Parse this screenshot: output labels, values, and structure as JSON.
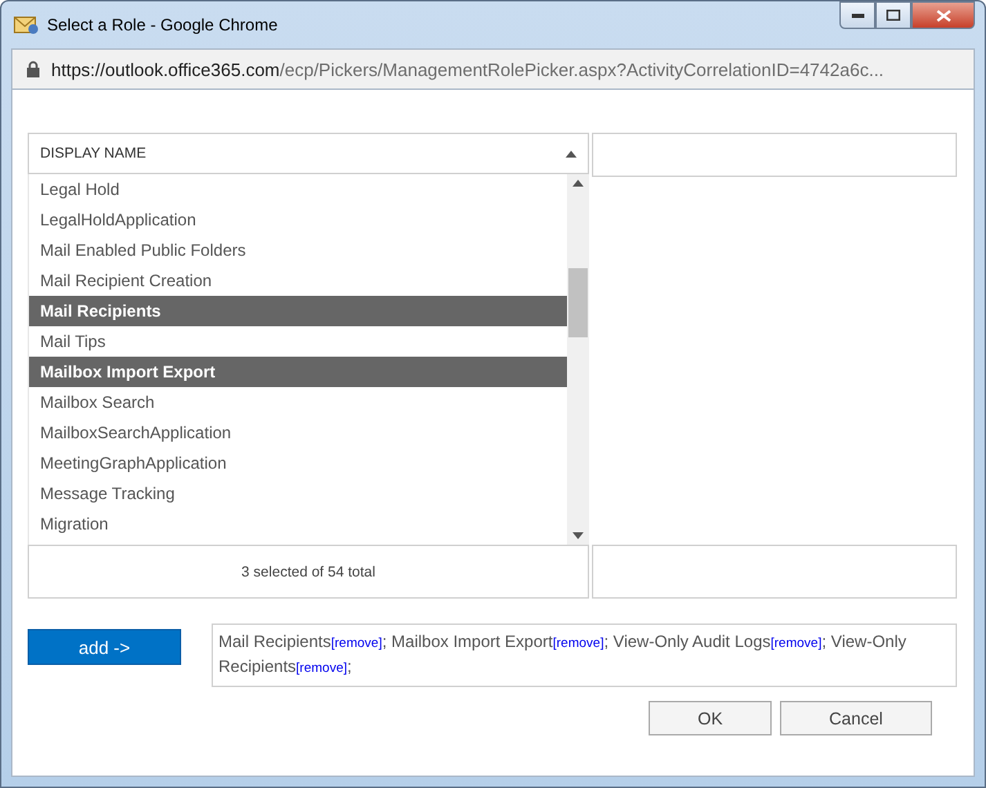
{
  "window": {
    "title": "Select a Role - Google Chrome"
  },
  "address_bar": {
    "host": "https://outlook.office365.com",
    "path": "/ecp/Pickers/ManagementRolePicker.aspx?ActivityCorrelationID=4742a6c..."
  },
  "list": {
    "header": "DISPLAY NAME",
    "items": [
      {
        "label": "Legal Hold",
        "selected": false
      },
      {
        "label": "LegalHoldApplication",
        "selected": false
      },
      {
        "label": "Mail Enabled Public Folders",
        "selected": false
      },
      {
        "label": "Mail Recipient Creation",
        "selected": false
      },
      {
        "label": "Mail Recipients",
        "selected": true
      },
      {
        "label": "Mail Tips",
        "selected": false
      },
      {
        "label": "Mailbox Import Export",
        "selected": true
      },
      {
        "label": "Mailbox Search",
        "selected": false
      },
      {
        "label": "MailboxSearchApplication",
        "selected": false
      },
      {
        "label": "MeetingGraphApplication",
        "selected": false
      },
      {
        "label": "Message Tracking",
        "selected": false
      },
      {
        "label": "Migration",
        "selected": false
      }
    ],
    "status": "3 selected of 54 total"
  },
  "add_button": "add ->",
  "selected_roles": [
    {
      "name": "Mail Recipients",
      "link": "[remove]",
      "separator": ";"
    },
    {
      "name": "Mailbox Import Export",
      "link": "[remove]",
      "separator": ";"
    },
    {
      "name": "View-Only Audit Logs",
      "link": "[remove]",
      "separator": ";"
    },
    {
      "name": "View-Only Recipients",
      "link": "[remove]",
      "separator": ";"
    }
  ],
  "buttons": [
    "OK",
    "Cancel"
  ]
}
